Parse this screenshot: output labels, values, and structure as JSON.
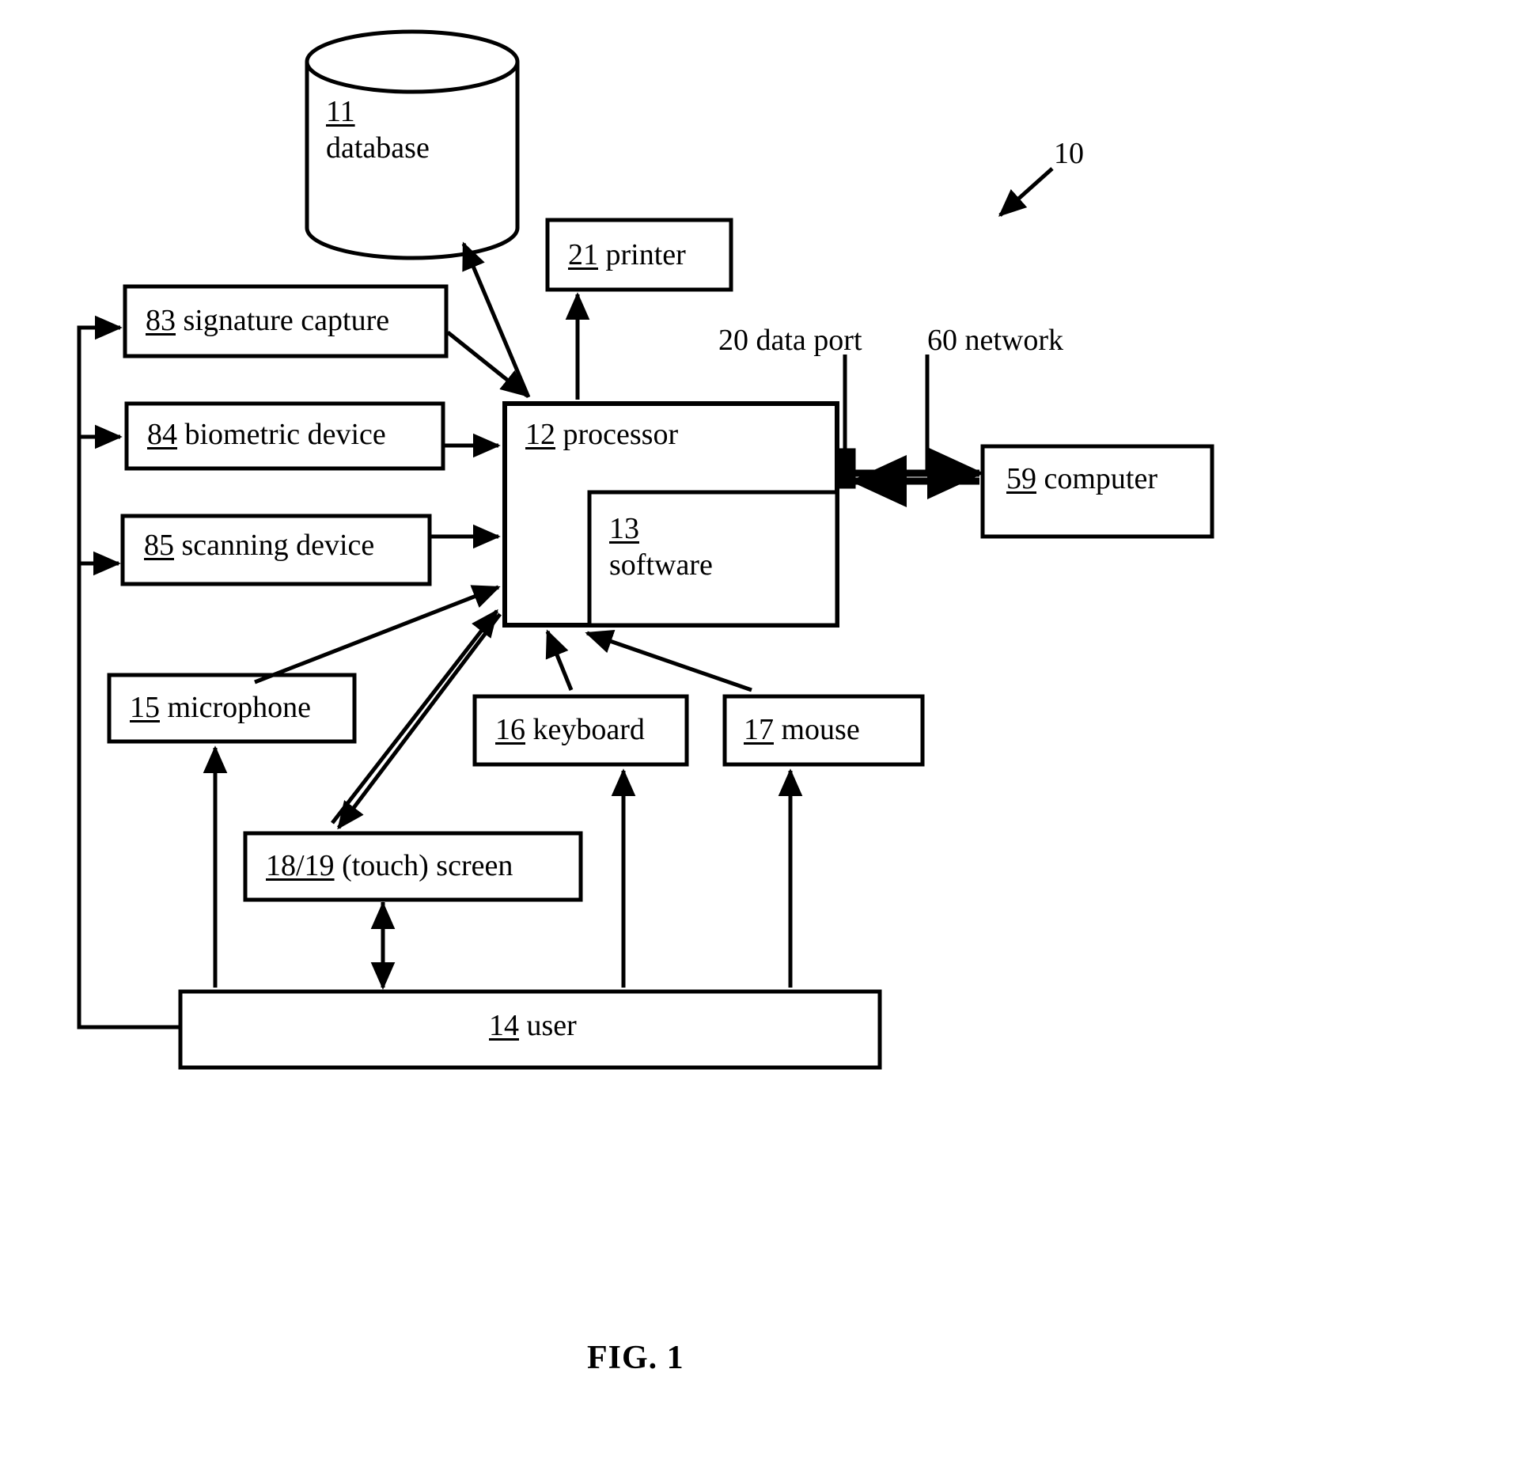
{
  "figure": {
    "caption": "FIG. 1",
    "system_ref": "10"
  },
  "nodes": {
    "database": {
      "ref": "11",
      "label": "database",
      "shape": "cylinder"
    },
    "printer": {
      "ref": "21",
      "label": "printer",
      "shape": "box"
    },
    "signature_capture": {
      "ref": "83",
      "label": "signature capture",
      "shape": "box"
    },
    "biometric_device": {
      "ref": "84",
      "label": "biometric device",
      "shape": "box"
    },
    "scanning_device": {
      "ref": "85",
      "label": "scanning device",
      "shape": "box"
    },
    "processor": {
      "ref": "12",
      "label": "processor",
      "shape": "box"
    },
    "software": {
      "ref": "13",
      "label": "software",
      "shape": "box"
    },
    "computer": {
      "ref": "59",
      "label": "computer",
      "shape": "box"
    },
    "microphone": {
      "ref": "15",
      "label": "microphone",
      "shape": "box"
    },
    "keyboard": {
      "ref": "16",
      "label": "keyboard",
      "shape": "box"
    },
    "mouse": {
      "ref": "17",
      "label": "mouse",
      "shape": "box"
    },
    "touch_screen": {
      "ref": "18/19",
      "label": "(touch) screen",
      "shape": "box"
    },
    "user": {
      "ref": "14",
      "label": "user",
      "shape": "box"
    }
  },
  "annotations": {
    "data_port": "20 data port",
    "network": "60 network"
  },
  "colors": {
    "line": "#000000",
    "background": "#ffffff",
    "text": "#000000"
  }
}
